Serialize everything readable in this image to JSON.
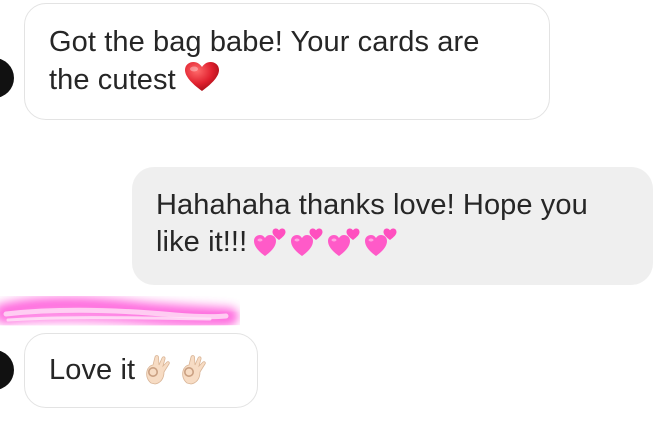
{
  "messages": [
    {
      "direction": "incoming",
      "line1": "Got the bag babe! Your cards are",
      "line2": "the cutest",
      "emoji": "red-heart"
    },
    {
      "direction": "outgoing",
      "line1": "Hahahaha thanks love! Hope you",
      "line2": "like it!!!",
      "emoji": "two-pink-hearts x4"
    },
    {
      "direction": "incoming",
      "line1": "Love it",
      "emoji": "ok-hand x2"
    }
  ],
  "redaction": {
    "color": "#ff4fd8",
    "description": "pink highlighter scribble over sender username"
  },
  "colors": {
    "incoming_bubble_bg": "#ffffff",
    "incoming_bubble_border": "#e3e3e3",
    "outgoing_bubble_bg": "#efefef",
    "text": "#262626",
    "heart": "#e0202e",
    "pink_heart": "#ff5ac8"
  }
}
